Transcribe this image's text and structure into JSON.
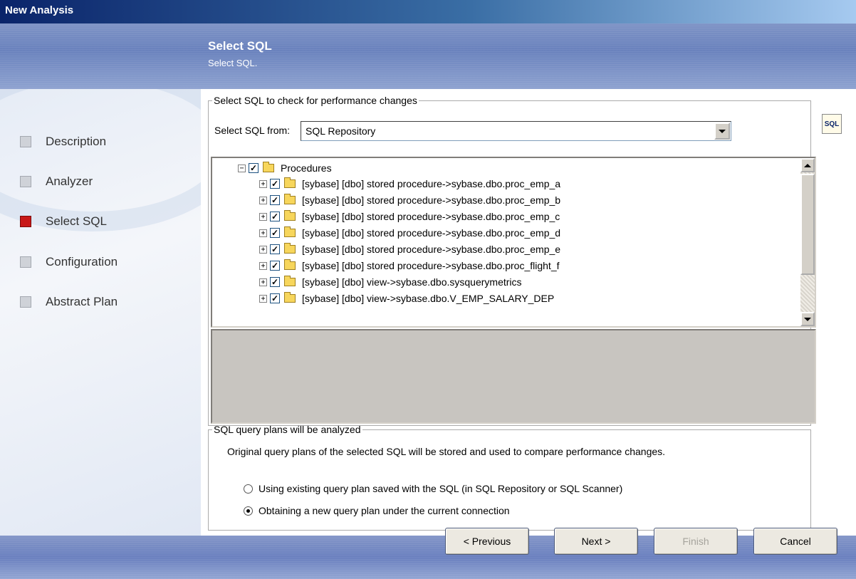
{
  "window": {
    "title": "New Analysis"
  },
  "header": {
    "title": "Select SQL",
    "subtitle": "Select SQL."
  },
  "sidebar": {
    "items": [
      {
        "label": "Description",
        "active": false
      },
      {
        "label": "Analyzer",
        "active": false
      },
      {
        "label": "Select SQL",
        "active": true
      },
      {
        "label": "Configuration",
        "active": false
      },
      {
        "label": "Abstract Plan",
        "active": false
      }
    ]
  },
  "select_group": {
    "legend": "Select SQL to check for performance changes",
    "select_label": "Select SQL from:",
    "select_value": "SQL Repository",
    "sql_button_label": "SQL"
  },
  "tree": {
    "root": {
      "label": "Procedures",
      "expander": "−",
      "checked": true
    },
    "items": [
      {
        "label": "[sybase] [dbo] stored procedure->sybase.dbo.proc_emp_a",
        "expander": "+",
        "checked": true
      },
      {
        "label": "[sybase] [dbo] stored procedure->sybase.dbo.proc_emp_b",
        "expander": "+",
        "checked": true
      },
      {
        "label": "[sybase] [dbo] stored procedure->sybase.dbo.proc_emp_c",
        "expander": "+",
        "checked": true
      },
      {
        "label": "[sybase] [dbo] stored procedure->sybase.dbo.proc_emp_d",
        "expander": "+",
        "checked": true
      },
      {
        "label": "[sybase] [dbo] stored procedure->sybase.dbo.proc_emp_e",
        "expander": "+",
        "checked": true
      },
      {
        "label": "[sybase] [dbo] stored procedure->sybase.dbo.proc_flight_f",
        "expander": "+",
        "checked": true
      },
      {
        "label": "[sybase] [dbo] view->sybase.dbo.sysquerymetrics",
        "expander": "+",
        "checked": true
      },
      {
        "label": "[sybase] [dbo] view->sybase.dbo.V_EMP_SALARY_DEP",
        "expander": "+",
        "checked": true
      }
    ]
  },
  "plans_group": {
    "legend": "SQL query plans will be analyzed",
    "description": "Original query plans of the selected SQL will be stored and used to compare performance changes.",
    "options": [
      {
        "label": "Using existing query plan saved with the SQL (in SQL Repository or SQL Scanner)",
        "selected": false
      },
      {
        "label": "Obtaining a new query plan under the current connection",
        "selected": true
      }
    ]
  },
  "buttons": {
    "previous": "< Previous",
    "next": "Next >",
    "finish": "Finish",
    "cancel": "Cancel"
  },
  "colors": {
    "title_bar": "#0a246a",
    "active_step": "#c81818",
    "inactive_step": "#cfd2d8",
    "header_band": "#6a82bd"
  }
}
